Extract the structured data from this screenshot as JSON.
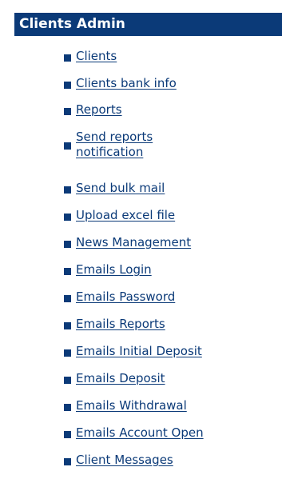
{
  "panel": {
    "title": "Clients Admin",
    "accent_color": "#0b3a78",
    "bullet_icon": "square-bullet-icon",
    "items": [
      {
        "label": "Clients"
      },
      {
        "label": "Clients bank info"
      },
      {
        "label": "Reports"
      },
      {
        "label": "Send reports notification"
      },
      {
        "label": "Send bulk mail"
      },
      {
        "label": "Upload excel file"
      },
      {
        "label": "News Management"
      },
      {
        "label": "Emails Login"
      },
      {
        "label": "Emails Password"
      },
      {
        "label": "Emails Reports"
      },
      {
        "label": "Emails Initial Deposit"
      },
      {
        "label": "Emails Deposit"
      },
      {
        "label": "Emails Withdrawal"
      },
      {
        "label": "Emails Account Open"
      },
      {
        "label": "Client Messages"
      }
    ]
  }
}
